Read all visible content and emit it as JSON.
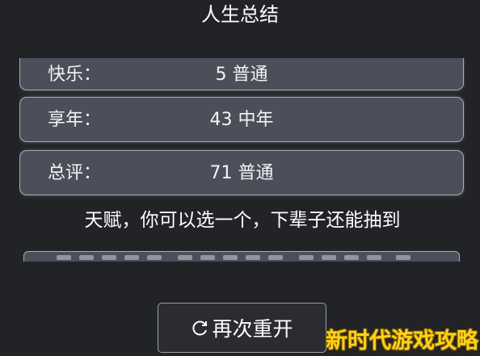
{
  "header": {
    "title": "人生总结"
  },
  "stats": [
    {
      "label": "快乐：",
      "value": "5 普通"
    },
    {
      "label": "享年：",
      "value": "43 中年"
    },
    {
      "label": "总评：",
      "value": "71 普通"
    }
  ],
  "talent": {
    "heading": "天赋，你可以选一个，下辈子还能抽到"
  },
  "restart": {
    "label": "再次重开"
  },
  "watermark": {
    "text": "新时代游戏攻略"
  },
  "colors": {
    "background": "#222327",
    "panel": "#4b4f5a",
    "panel_border": "#a9adb7",
    "watermark": "#ffd21a"
  }
}
